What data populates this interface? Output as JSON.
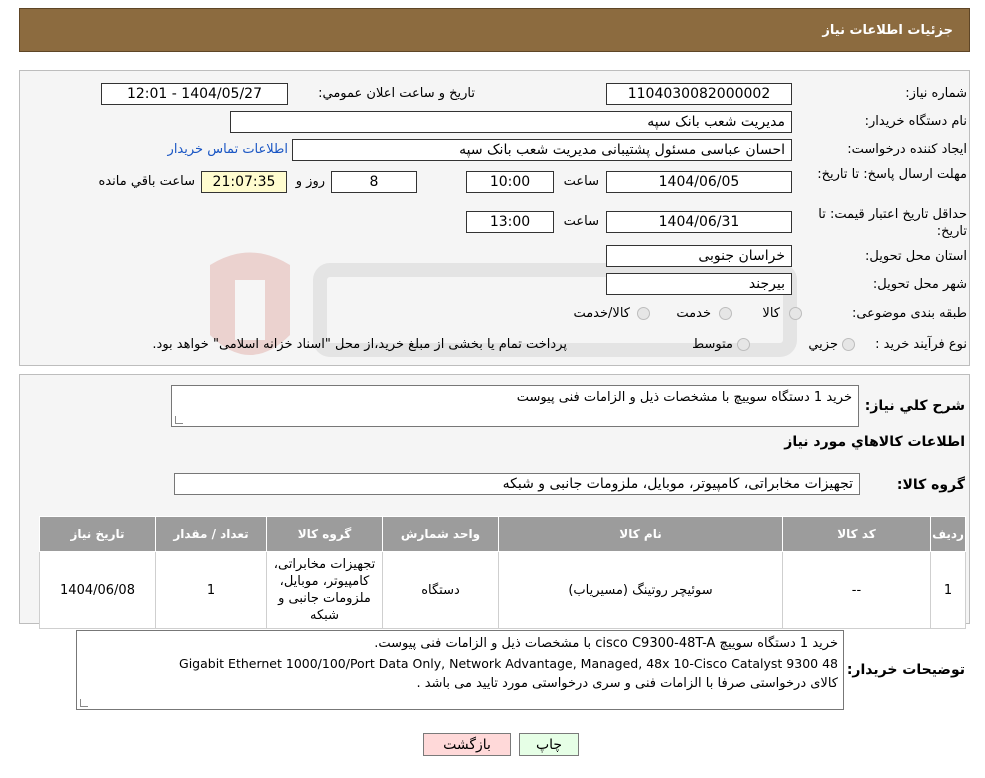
{
  "header": {
    "title": "جزئیات اطلاعات نیاز"
  },
  "form": {
    "need_number_label": "شماره نیاز:",
    "need_number": "1104030082000002",
    "announce_label": "تاریخ و ساعت اعلان عمومي:",
    "announce_value": "1404/05/27 - 12:01",
    "buyer_org_label": "نام دستگاه خریدار:",
    "buyer_org": "مدیریت شعب بانک سپه",
    "requester_label": "ایجاد کننده درخواست:",
    "requester": "احسان عباسی مسئول پشتیبانی مدیریت شعب بانک سپه",
    "contact_link": "اطلاعات تماس خریدار",
    "reply_deadline_label": "مهلت ارسال پاسخ: تا تاریخ:",
    "reply_date": "1404/06/05",
    "time_label": "ساعت",
    "reply_time": "10:00",
    "days_value": "8",
    "days_label": "روز و",
    "remaining_time": "21:07:35",
    "remaining_label": "ساعت باقي مانده",
    "validity_label": "حداقل تاریخ اعتبار قیمت: تا تاریخ:",
    "validity_date": "1404/06/31",
    "validity_time": "13:00",
    "province_label": "استان محل تحویل:",
    "province": "خراسان جنوبی",
    "city_label": "شهر محل تحویل:",
    "city": "بیرجند",
    "category_label": "طبقه بندی موضوعی:",
    "category_options": [
      "کالا",
      "خدمت",
      "کالا/خدمت"
    ],
    "process_label": "نوع فرآیند خرید :",
    "process_options": [
      "جزیي",
      "متوسط"
    ],
    "process_note": "پرداخت تمام یا بخشی از مبلغ خرید،از محل \"اسناد خزانه اسلامی\" خواهد بود."
  },
  "description": {
    "label": "شرح کلي نياز:",
    "text": "خرید 1 دستگاه سوییچ با مشخصات ذیل و الزامات فنی پیوست"
  },
  "goods": {
    "section_title": "اطلاعات کالاهاي مورد نياز",
    "group_label": "گروه کالا:",
    "group_value": "تجهیزات مخابراتی، کامپیوتر، موبایل، ملزومات جانبی و شبکه",
    "columns": [
      "رديف",
      "کد کالا",
      "نام کالا",
      "واحد شمارش",
      "گروه کالا",
      "تعداد / مقدار",
      "تاريخ نياز"
    ],
    "rows": [
      {
        "index": "1",
        "code": "--",
        "name": "سوئیچر روتینگ (مسیریاب)",
        "unit": "دستگاه",
        "group": "تجهیزات مخابراتی، کامپیوتر، موبایل، ملزومات جانبی و شبکه",
        "qty": "1",
        "date": "1404/06/08"
      }
    ]
  },
  "buyer_notes": {
    "label": "توضیحات خریدار:",
    "line1": "خرید 1 دستگاه سوییچ cisco C9300-48T-A  با مشخصات ذیل و الزامات فنی پیوست.",
    "line2": "Gigabit Ethernet 1000/100/Port Data Only, Network Advantage, Managed, 48x 10-Cisco Catalyst 9300 48",
    "line3": "کالای درخواستی صرفا با الزامات فنی و سری درخواستی  مورد تایید می باشد ."
  },
  "buttons": {
    "print": "چاپ",
    "back": "بازگشت"
  },
  "colors": {
    "header_bg": "#8c6b3f",
    "table_header": "#9c9c9c",
    "back_btn": "#ffd9d9",
    "print_btn": "#e6ffe6"
  }
}
